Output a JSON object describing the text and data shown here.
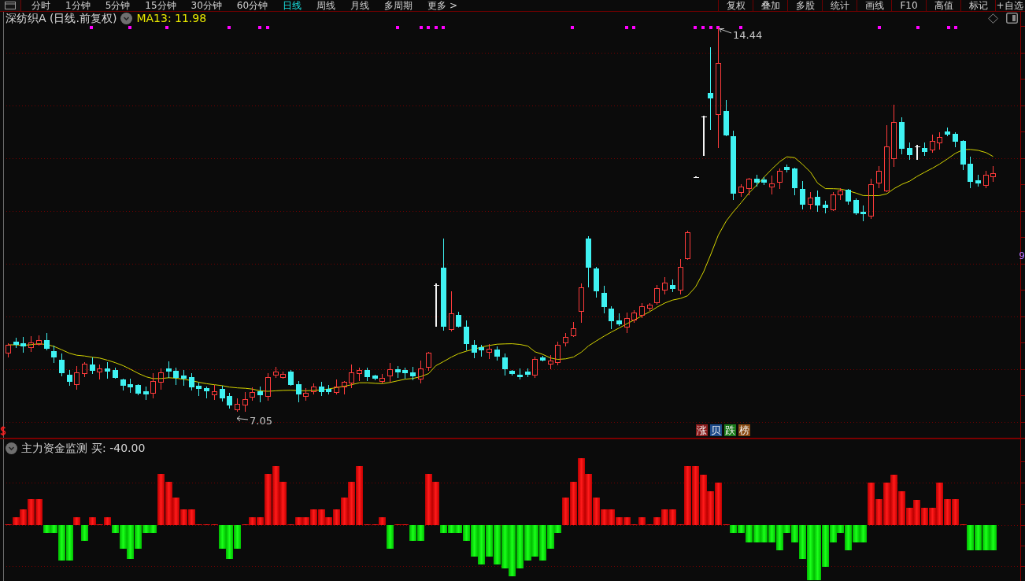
{
  "toolbar": {
    "periods": [
      {
        "label": "分时",
        "selected": false
      },
      {
        "label": "1分钟",
        "selected": false
      },
      {
        "label": "5分钟",
        "selected": false
      },
      {
        "label": "15分钟",
        "selected": false
      },
      {
        "label": "30分钟",
        "selected": false
      },
      {
        "label": "60分钟",
        "selected": false
      },
      {
        "label": "日线",
        "selected": true
      },
      {
        "label": "周线",
        "selected": false
      },
      {
        "label": "月线",
        "selected": false
      },
      {
        "label": "多周期",
        "selected": false
      },
      {
        "label": "更多 >",
        "selected": false
      }
    ],
    "tools": [
      "复权",
      "叠加",
      "多股",
      "统计",
      "画线",
      "F10",
      "高值",
      "标记",
      "+自选"
    ]
  },
  "price_panel": {
    "title": "深纺织A (日线.前复权)",
    "ma_label": "MA13: 11.98",
    "high_label": "14.44",
    "low_label": "7.05",
    "axis_marker": "9",
    "badges": [
      {
        "label": "涨",
        "color": "#8c1c1c"
      },
      {
        "label": "贝",
        "color": "#1d4a8a"
      },
      {
        "label": "跌",
        "color": "#1a7a1a"
      },
      {
        "label": "榜",
        "color": "#8a4a12"
      }
    ]
  },
  "indicator_panel": {
    "name": "主力资金监测",
    "reading": "买: -40.00"
  }
}
